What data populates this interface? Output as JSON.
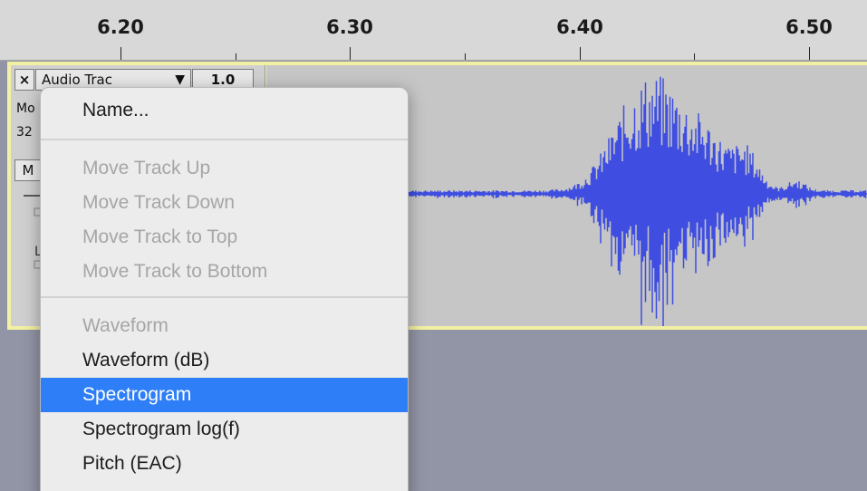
{
  "ruler": {
    "labels": [
      "6.20",
      "6.30",
      "6.40",
      "6.50"
    ]
  },
  "track": {
    "close_label": "×",
    "name": "Audio Trac",
    "dropdown_arrow": "▼",
    "gain_label": "1.0",
    "info_line_1": "Mo",
    "info_line_2": "32",
    "mute_label": "M",
    "waveform_color": "#3f4ee0"
  },
  "menu": {
    "items": [
      {
        "label": "Name...",
        "enabled": true
      },
      {
        "label": "Move Track Up",
        "enabled": false
      },
      {
        "label": "Move Track Down",
        "enabled": false
      },
      {
        "label": "Move Track to Top",
        "enabled": false
      },
      {
        "label": "Move Track to Bottom",
        "enabled": false
      },
      {
        "label": "Waveform",
        "enabled": false
      },
      {
        "label": "Waveform (dB)",
        "enabled": true
      },
      {
        "label": "Spectrogram",
        "enabled": true,
        "selected": true
      },
      {
        "label": "Spectrogram log(f)",
        "enabled": true
      },
      {
        "label": "Pitch (EAC)",
        "enabled": true
      }
    ],
    "selected_color": "#2d7ef7"
  }
}
